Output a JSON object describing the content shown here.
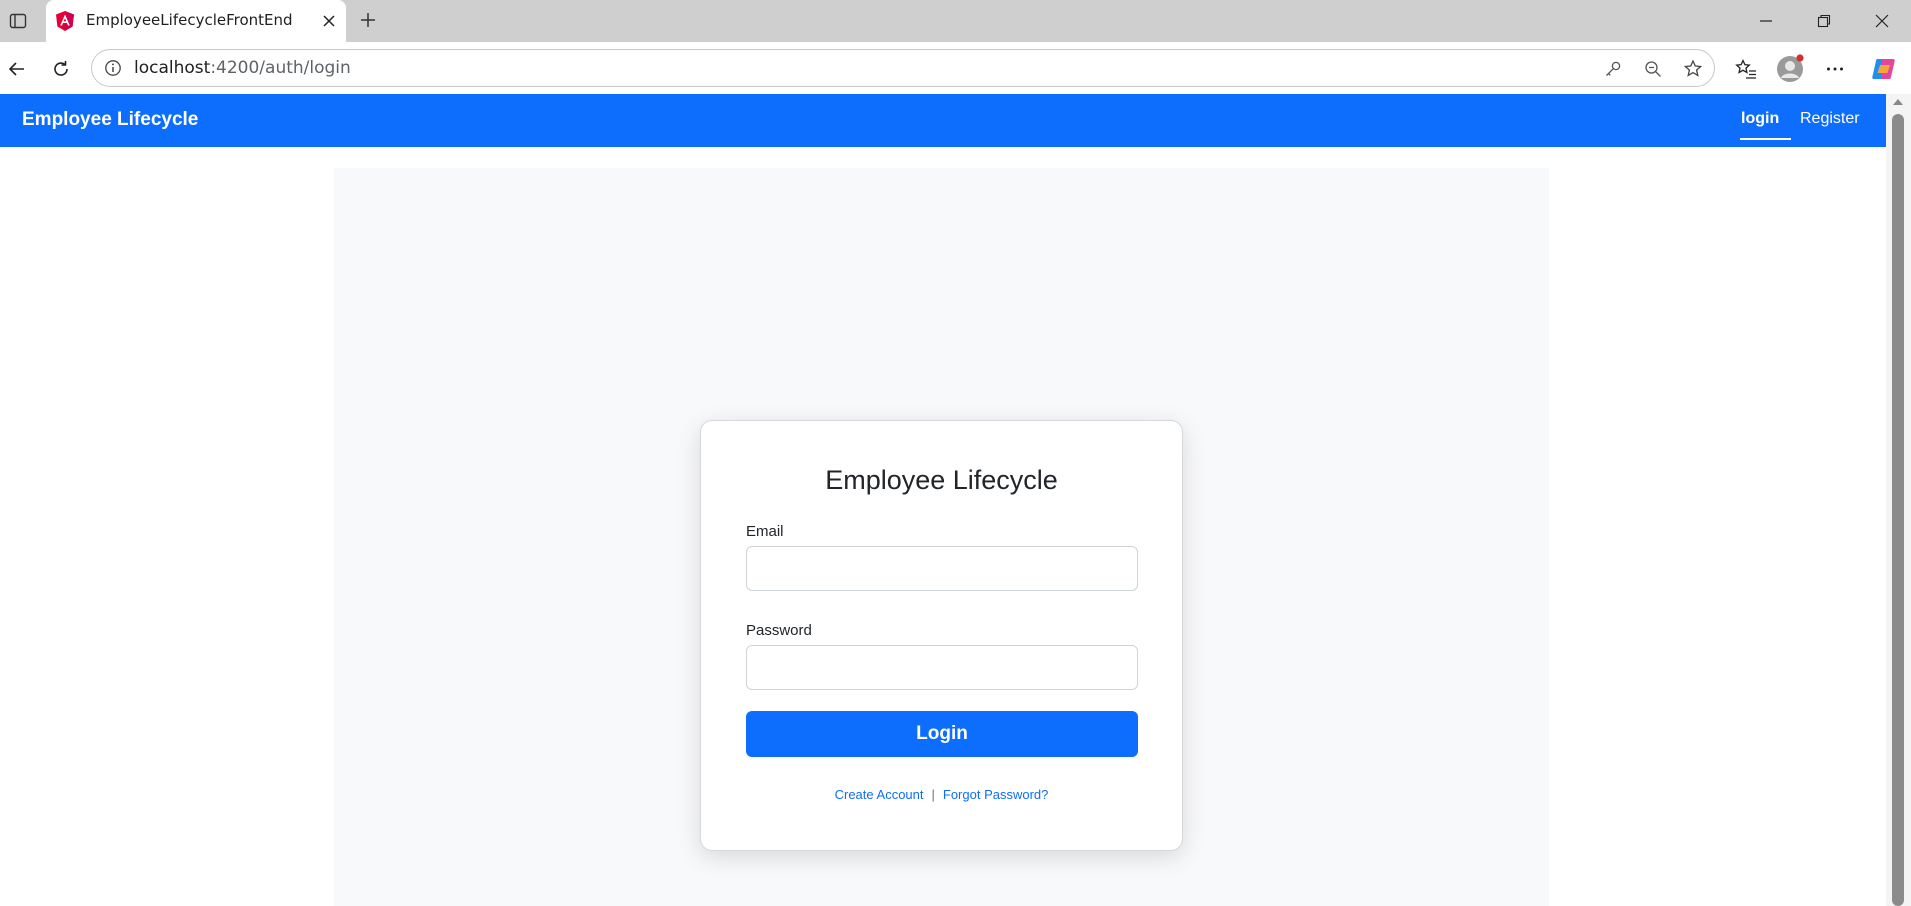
{
  "browser": {
    "tab_title": "EmployeeLifecycleFrontEnd",
    "url_host": "localhost",
    "url_path": ":4200/auth/login",
    "icons": {
      "tab_strip": "tab-strip-icon",
      "favicon": "angular-logo-icon",
      "tab_close": "close-icon",
      "new_tab": "plus-icon",
      "back": "arrow-left-icon",
      "reload": "reload-icon",
      "site_info": "info-icon",
      "key": "key-icon",
      "zoom": "zoom-out-icon",
      "favorite": "star-icon",
      "favorites": "favorites-list-icon",
      "profile": "profile-icon",
      "more": "more-icon",
      "copilot": "copilot-icon",
      "minimize": "minimize-icon",
      "restore": "restore-icon",
      "close_window": "close-window-icon"
    }
  },
  "navbar": {
    "brand": "Employee Lifecycle",
    "links": [
      {
        "label": "login",
        "active": true
      },
      {
        "label": "Register",
        "active": false
      }
    ],
    "color": "#0d6efd"
  },
  "login_card": {
    "title": "Employee Lifecycle",
    "email_label": "Email",
    "email_value": "",
    "password_label": "Password",
    "password_value": "",
    "submit_label": "Login",
    "create_account_link": "Create Account",
    "separator": "|",
    "forgot_password_link": "Forgot Password?"
  },
  "colors": {
    "primary": "#0d6efd",
    "container_background": "#f8f9fa"
  }
}
